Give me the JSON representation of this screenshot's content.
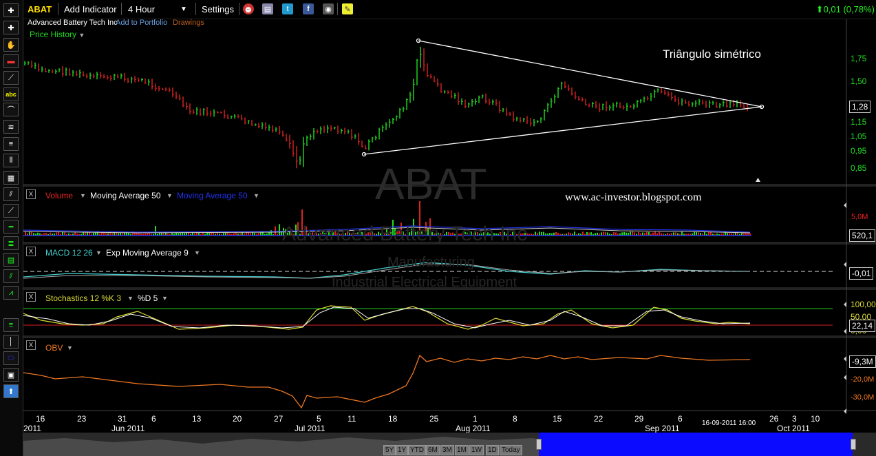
{
  "toolbar": {
    "symbol": "ABAT",
    "add_indicator": "Add Indicator",
    "interval": "4 Hour",
    "settings": "Settings",
    "change": "0,01 (0,78%)",
    "company": "Advanced Battery Tech Inc",
    "add_to_portfolio": "Add to Portfolio",
    "drawings": "Drawings"
  },
  "left_tools": [
    "crosshair-icon",
    "crosshair-plus-icon",
    "hand-icon",
    "eraser-icon",
    "trendline-icon",
    "text-abc-icon",
    "arc-icon",
    "fan-icon",
    "fibonacci-icon",
    "vertical-lines-icon",
    "gann-icon",
    "pitchfork-icon",
    "speed-lines-icon",
    "horizontal-line-icon",
    "channel-icon",
    "parallel-lines-icon",
    "regression-icon",
    "zigzag-icon",
    "cycle-lines-icon",
    "vertical-line-icon",
    "ellipse-icon",
    "rectangle-icon",
    "arrow-up-icon"
  ],
  "price_panel": {
    "title": "Price History",
    "watermark_symbol": "ABAT",
    "watermark_company": "Advanced Battery Tech Inc",
    "watermark_sector": "Manufacturing",
    "watermark_industry": "Industrial Electrical Equipment",
    "annotation": "Triângulo simétrico",
    "y_ticks": [
      "1,75",
      "1,50",
      "1,28",
      "1,15",
      "1,05",
      "0,95",
      "0,85"
    ],
    "last_price": "1,28"
  },
  "volume_panel": {
    "label": "Volume",
    "ma1": "Moving Average 50",
    "ma2": "Moving Average 50",
    "url": "www.ac-investor.blogspot.com",
    "y_tick": "5,0M",
    "last_value": "520,1"
  },
  "macd_panel": {
    "label": "MACD 12 26",
    "signal": "Exp Moving Average 9",
    "last_value": "-0,01"
  },
  "stoch_panel": {
    "label": "Stochastics 12 %K 3",
    "d_label": "%D 5",
    "ticks": [
      "100,00",
      "50,00",
      "0,00"
    ],
    "last_value": "22,14"
  },
  "obv_panel": {
    "label": "OBV",
    "ticks": [
      "-20,0M",
      "-30,0M"
    ],
    "last_value": "-9,3M"
  },
  "x_axis": {
    "days": [
      "16",
      "23",
      "31",
      "6",
      "13",
      "20",
      "27",
      "5",
      "11",
      "18",
      "25",
      "1",
      "8",
      "15",
      "22",
      "29",
      "6",
      "26",
      "3",
      "10"
    ],
    "months": [
      "2011",
      "Jun 2011",
      "Jul 2011",
      "Aug 2011",
      "Sep 2011",
      "Oct 2011"
    ],
    "cursor_time": "16-09-2011 16:00"
  },
  "range_buttons": [
    "5Y",
    "1Y",
    "YTD",
    "6M",
    "3M",
    "1M",
    "1W",
    "1D",
    "Today"
  ],
  "colors": {
    "up": "#22dd22",
    "down": "#dd2222",
    "accent": "#2233ee"
  }
}
